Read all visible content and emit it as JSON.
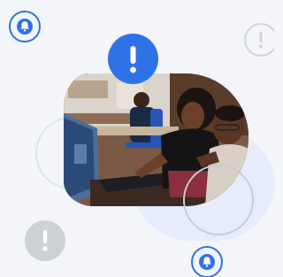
{
  "illustration": {
    "photo_subject": "team-at-computer-photo",
    "colors": {
      "accent": "#2f72e8",
      "background": "#f3f5f8",
      "muted_gray": "#cdd0d5",
      "blob": "#e6ecfb"
    },
    "icons": {
      "alert_blue": "exclamation-icon",
      "alert_outline": "exclamation-icon",
      "alert_gray": "exclamation-icon",
      "bell_top": "bell-icon",
      "bell_bottom": "bell-icon"
    }
  }
}
